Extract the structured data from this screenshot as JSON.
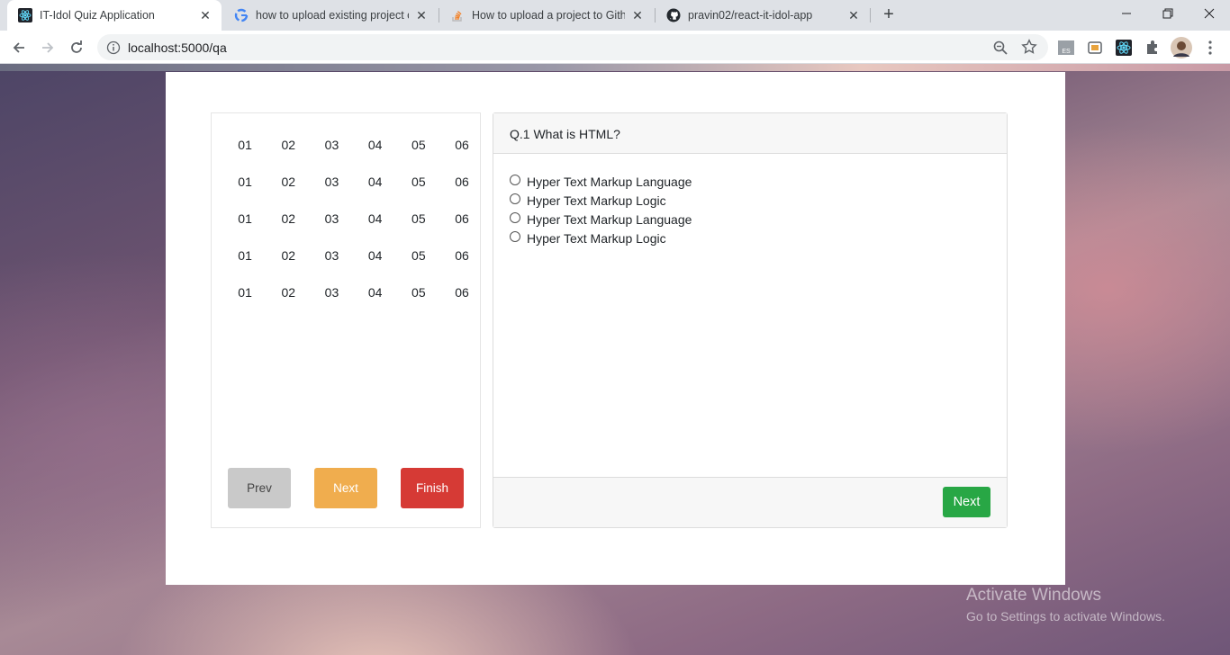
{
  "browser": {
    "tabs": [
      {
        "title": "IT-Idol Quiz Application",
        "icon": "react-icon",
        "active": true
      },
      {
        "title": "how to upload existing project o",
        "icon": "google-icon",
        "active": false
      },
      {
        "title": "How to upload a project to Githu",
        "icon": "stackoverflow-icon",
        "active": false
      },
      {
        "title": "pravin02/react-it-idol-app",
        "icon": "github-icon",
        "active": false
      }
    ],
    "url": "localhost:5000/qa"
  },
  "navigator": {
    "rows": [
      [
        "01",
        "02",
        "03",
        "04",
        "05",
        "06"
      ],
      [
        "01",
        "02",
        "03",
        "04",
        "05",
        "06"
      ],
      [
        "01",
        "02",
        "03",
        "04",
        "05",
        "06"
      ],
      [
        "01",
        "02",
        "03",
        "04",
        "05",
        "06"
      ],
      [
        "01",
        "02",
        "03",
        "04",
        "05",
        "06"
      ]
    ],
    "prev_label": "Prev",
    "next_label": "Next",
    "finish_label": "Finish"
  },
  "question": {
    "title": "Q.1 What is HTML?",
    "options": [
      "Hyper Text Markup Language",
      "Hyper Text Markup Logic",
      "Hyper Text Markup Language",
      "Hyper Text Markup Logic"
    ],
    "next_label": "Next"
  },
  "watermark": {
    "line1": "Activate Windows",
    "line2": "Go to Settings to activate Windows."
  },
  "colors": {
    "prev": "#c9c9c9",
    "next": "#f0ad4e",
    "finish": "#d63a35",
    "question_next": "#28a745"
  }
}
